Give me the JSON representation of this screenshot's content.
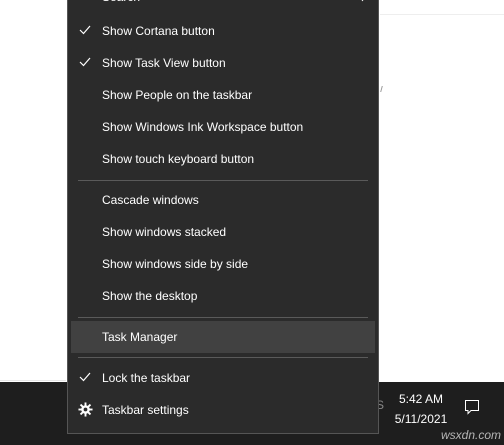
{
  "menu": {
    "search": "Search",
    "show_cortana": "Show Cortana button",
    "show_task_view": "Show Task View button",
    "show_people": "Show People on the taskbar",
    "show_ink": "Show Windows Ink Workspace button",
    "show_touch_keyboard": "Show touch keyboard button",
    "cascade": "Cascade windows",
    "stacked": "Show windows stacked",
    "side_by_side": "Show windows side by side",
    "show_desktop": "Show the desktop",
    "task_manager": "Task Manager",
    "lock_taskbar": "Lock the taskbar",
    "taskbar_settings": "Taskbar settings"
  },
  "tray": {
    "time": "5:42 AM",
    "date": "5/11/2021",
    "separator": "S"
  },
  "watermark": "wsxdn.com",
  "colors": {
    "menu_bg": "#2b2b2b",
    "menu_hover": "#414141",
    "taskbar_bg": "#1e1e1e",
    "text": "#ffffff"
  }
}
